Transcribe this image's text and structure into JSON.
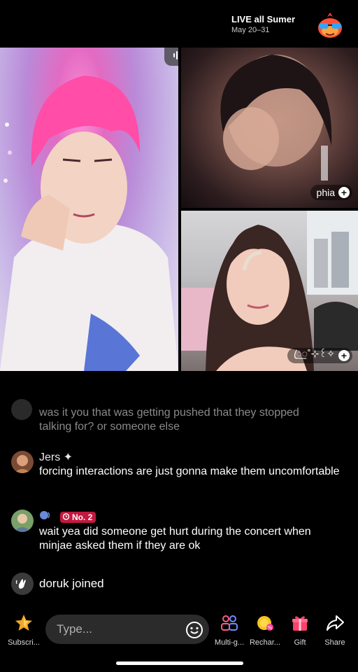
{
  "header": {
    "event_title": "LIVE all Sumer",
    "event_dates": "May 20–31",
    "mascot_icon": "sunglasses-mascot-icon"
  },
  "video": {
    "audio_icon": "audio-wave-icon",
    "guests": [
      {
        "name": "phia"
      },
      {
        "name": "ꦿ꯭˚⊹꒰✧"
      }
    ]
  },
  "chat": {
    "faded_message": "was it you that was getting pushed that they stopped talking for? or someone else",
    "messages": [
      {
        "username": "Jers ✦",
        "text": "forcing interactions are just gonna make them uncomfortable"
      },
      {
        "username": "",
        "badge": "No. 2",
        "text": "wait yea did someone get hurt during the concert when minjae asked them if they are ok"
      }
    ],
    "join": {
      "username": "doruk",
      "action": "joined"
    }
  },
  "bottom_bar": {
    "subscribe_label": "Subscri...",
    "input_placeholder": "Type...",
    "multi_guest_label": "Multi-g...",
    "recharge_label": "Rechar...",
    "gift_label": "Gift",
    "share_label": "Share"
  },
  "colors": {
    "background": "#000000",
    "badge": "#c2193f",
    "multi_guest_icon": "#ff5b7f",
    "gift_icon": "#ff3f6c"
  }
}
